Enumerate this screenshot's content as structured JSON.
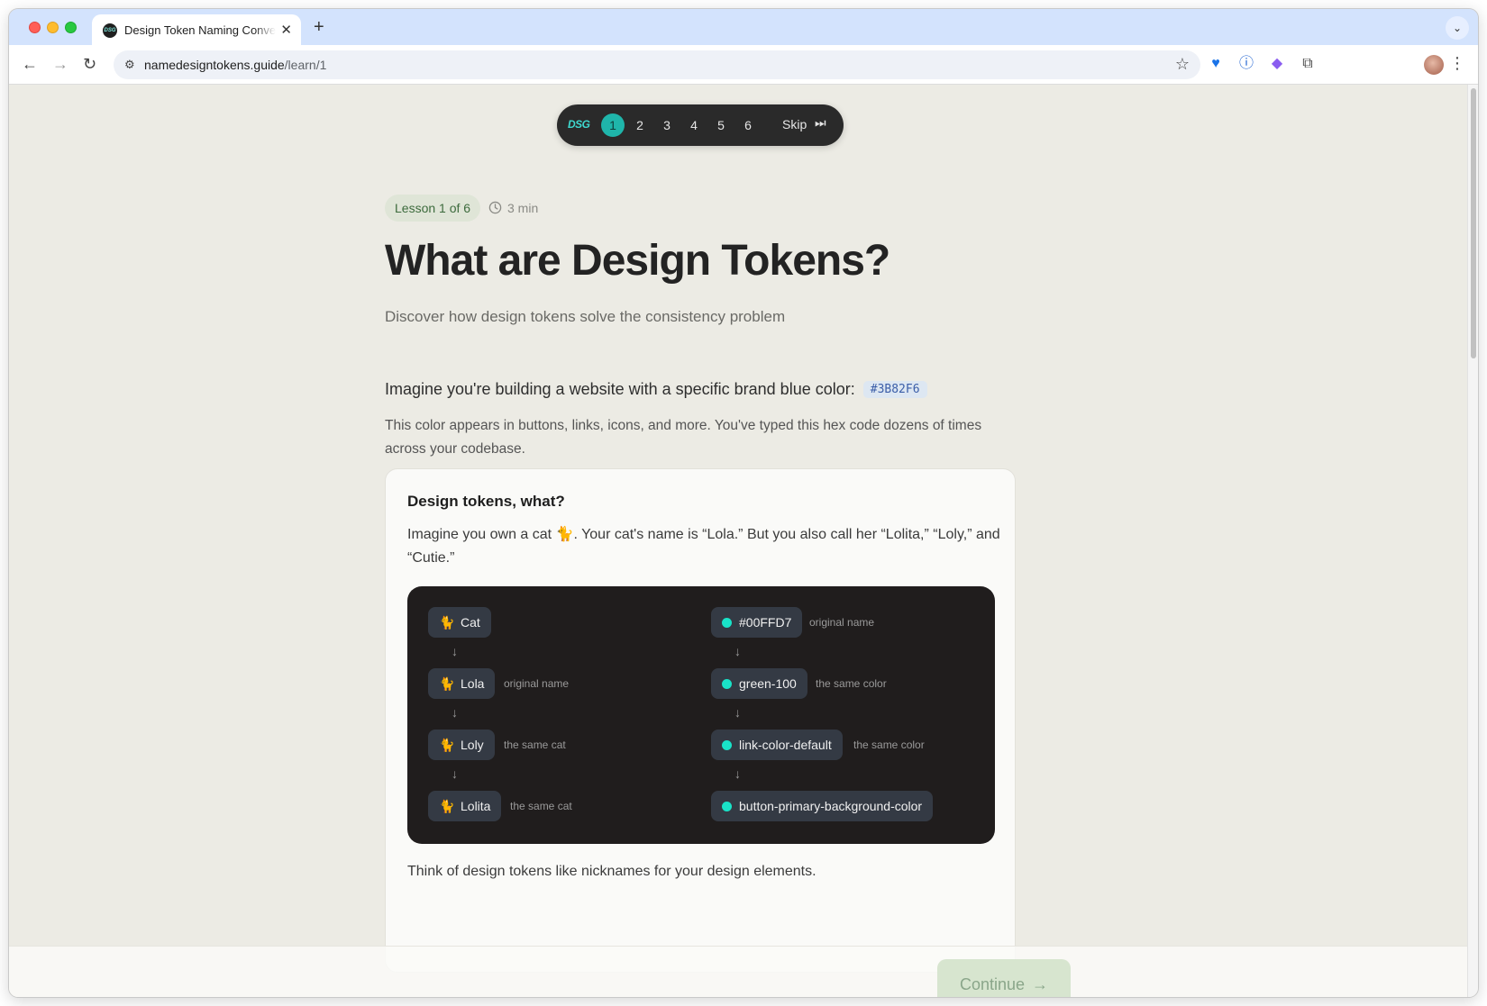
{
  "browser": {
    "tab_title": "Design Token Naming Conventions",
    "tab_favicon": "DSG",
    "url_host": "namedesigntokens.guide",
    "url_path": "/learn/1"
  },
  "stepper": {
    "logo": "DSG",
    "steps": [
      "1",
      "2",
      "3",
      "4",
      "5",
      "6"
    ],
    "active_step": "1",
    "skip_label": "Skip"
  },
  "lesson": {
    "badge": "Lesson 1 of 6",
    "duration": "3 min",
    "title": "What are Design Tokens?",
    "subtitle": "Discover how design tokens solve the consistency problem",
    "lead": "Imagine you're building a website with a specific brand blue color:",
    "hex_code": "#3B82F6",
    "paragraph": "This color appears in buttons, links, icons, and more. You've typed this hex code dozens of times across your codebase."
  },
  "card": {
    "title": "Design tokens, what?",
    "text": "Imagine you own a cat 🐈. Your cat's name is “Lola.” But you also call her “Lolita,” “Loly,” and “Cutie.”",
    "footer": "Think of design tokens like nicknames for your design elements."
  },
  "diagram": {
    "cat_column": [
      {
        "label": "Cat",
        "note": ""
      },
      {
        "label": "Lola",
        "note": "original name"
      },
      {
        "label": "Loly",
        "note": "the same cat"
      },
      {
        "label": "Lolita",
        "note": "the same cat"
      }
    ],
    "color_column": [
      {
        "label": "#00FFD7",
        "note": "original name"
      },
      {
        "label": "green-100",
        "note": "the same color"
      },
      {
        "label": "link-color-default",
        "note": "the same color"
      },
      {
        "label": "button-primary-background-color",
        "note": ""
      }
    ],
    "dot_color": "#19E3C8"
  },
  "footer": {
    "continue_label": "Continue"
  },
  "colors": {
    "accent": "#1FB5AA",
    "page_bg": "#ECEBE4"
  }
}
